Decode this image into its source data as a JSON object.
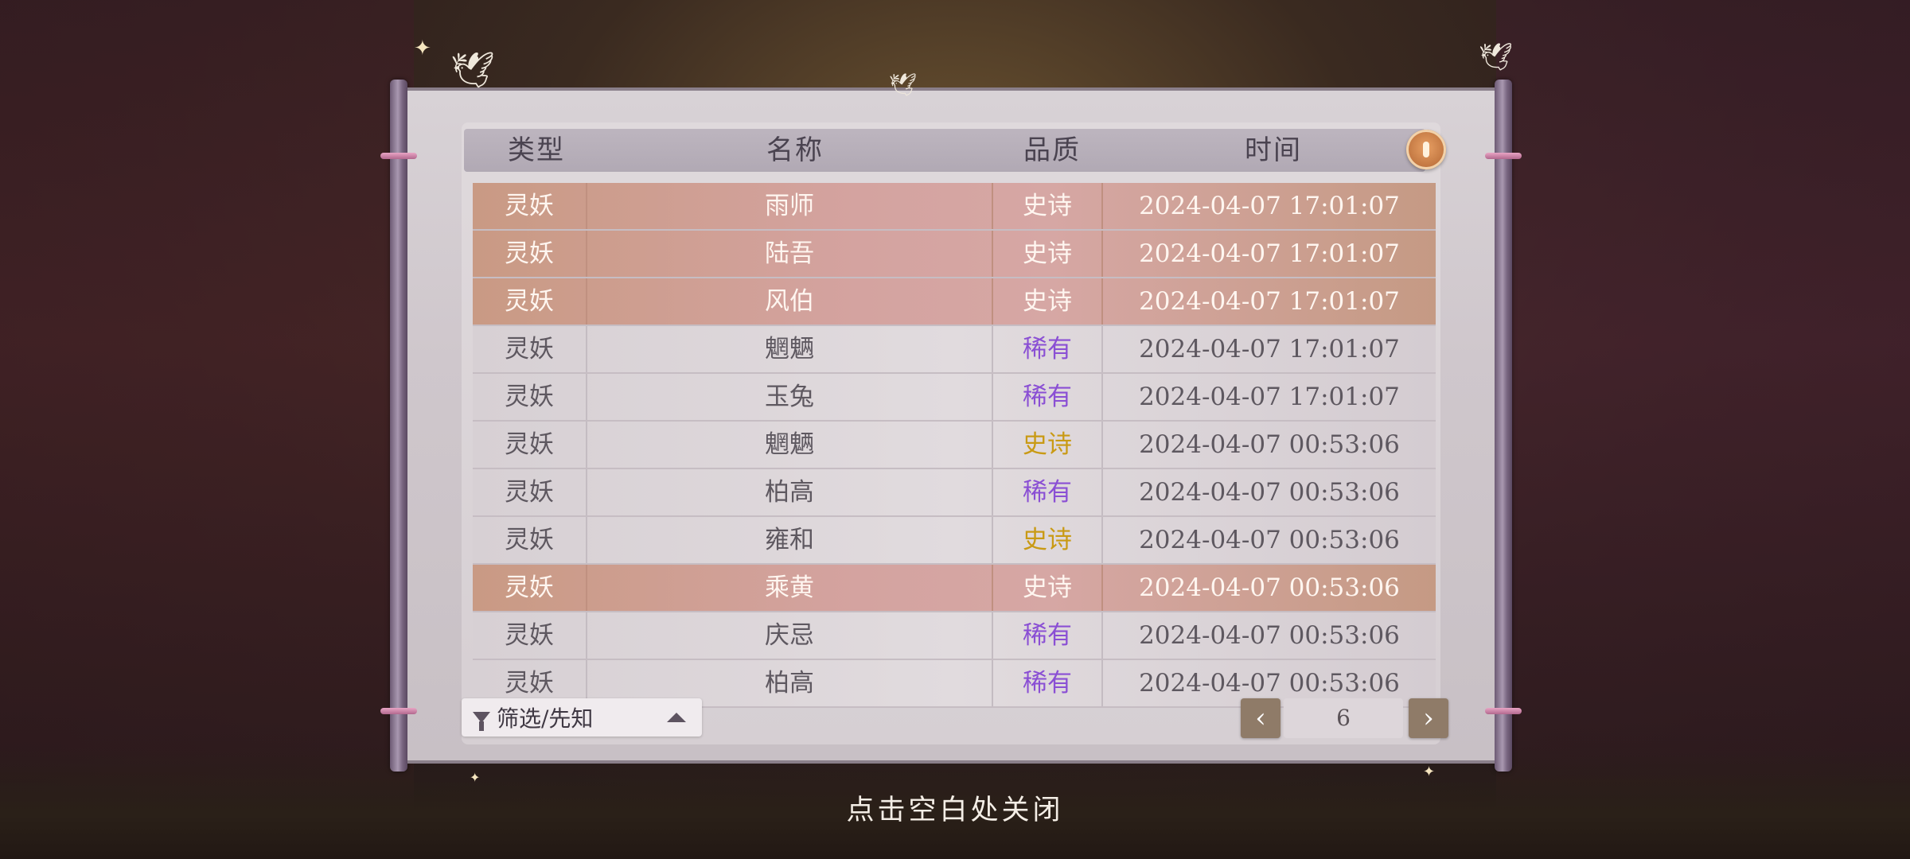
{
  "table": {
    "headers": {
      "type": "类型",
      "name": "名称",
      "quality": "品质",
      "time": "时间"
    },
    "rows": [
      {
        "type": "灵妖",
        "name": "雨师",
        "quality": "史诗",
        "time": "2024-04-07  17:01:07",
        "highlight": true,
        "quality_color": "epic"
      },
      {
        "type": "灵妖",
        "name": "陆吾",
        "quality": "史诗",
        "time": "2024-04-07  17:01:07",
        "highlight": true,
        "quality_color": "epic"
      },
      {
        "type": "灵妖",
        "name": "风伯",
        "quality": "史诗",
        "time": "2024-04-07  17:01:07",
        "highlight": true,
        "quality_color": "epic"
      },
      {
        "type": "灵妖",
        "name": "魍魉",
        "quality": "稀有",
        "time": "2024-04-07  17:01:07",
        "highlight": false,
        "quality_color": "rare"
      },
      {
        "type": "灵妖",
        "name": "玉兔",
        "quality": "稀有",
        "time": "2024-04-07  17:01:07",
        "highlight": false,
        "quality_color": "rare"
      },
      {
        "type": "灵妖",
        "name": "魍魉",
        "quality": "史诗",
        "time": "2024-04-07  00:53:06",
        "highlight": false,
        "quality_color": "epic"
      },
      {
        "type": "灵妖",
        "name": "柏高",
        "quality": "稀有",
        "time": "2024-04-07  00:53:06",
        "highlight": false,
        "quality_color": "rare"
      },
      {
        "type": "灵妖",
        "name": "雍和",
        "quality": "史诗",
        "time": "2024-04-07  00:53:06",
        "highlight": false,
        "quality_color": "epic"
      },
      {
        "type": "灵妖",
        "name": "乘黄",
        "quality": "史诗",
        "time": "2024-04-07  00:53:06",
        "highlight": true,
        "quality_color": "epic"
      },
      {
        "type": "灵妖",
        "name": "庆忌",
        "quality": "稀有",
        "time": "2024-04-07  00:53:06",
        "highlight": false,
        "quality_color": "rare"
      },
      {
        "type": "灵妖",
        "name": "柏高",
        "quality": "稀有",
        "time": "2024-04-07  00:53:06",
        "highlight": false,
        "quality_color": "rare"
      }
    ]
  },
  "filter": {
    "label": "筛选/先知"
  },
  "pagination": {
    "prev": "‹",
    "page": "6",
    "next": "›"
  },
  "close_hint": "点击空白处关闭",
  "colors": {
    "rare": "#8a4fd4",
    "epic": "#c99a14",
    "highlight_row": "#d4a3a0"
  },
  "icons": {
    "info": "info-icon",
    "filter": "filter-icon",
    "bird": "swallow-icon"
  }
}
